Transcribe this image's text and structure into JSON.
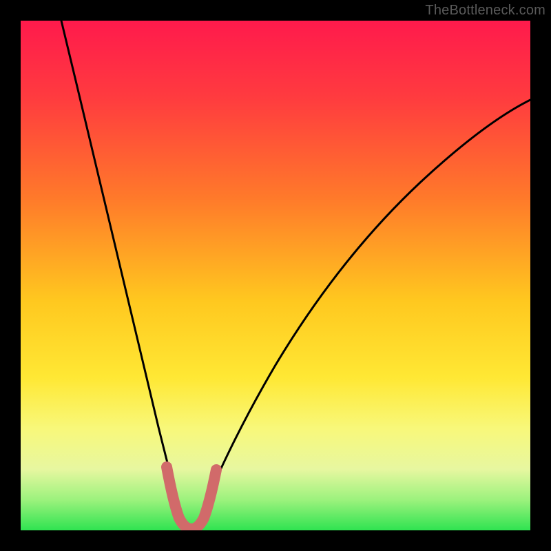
{
  "watermark": "TheBottleneck.com",
  "chart_data": {
    "type": "line",
    "title": "",
    "xlabel": "",
    "ylabel": "",
    "xlim": [
      0,
      100
    ],
    "ylim": [
      0,
      100
    ],
    "grid": false,
    "legend": false,
    "series": [
      {
        "name": "bottleneck-curve",
        "color": "#000000",
        "x": [
          8,
          10,
          12,
          14,
          16,
          18,
          20,
          22,
          24,
          26,
          28,
          30,
          31,
          32,
          33,
          34,
          36,
          38,
          40,
          44,
          48,
          52,
          56,
          60,
          64,
          68,
          72,
          76,
          80,
          84,
          88,
          92,
          96,
          100
        ],
        "y": [
          100,
          92,
          84,
          76,
          68,
          60,
          52,
          44,
          36,
          28,
          20,
          10,
          4,
          1,
          1,
          4,
          10,
          16,
          22,
          32,
          40,
          47,
          53,
          58,
          62,
          66,
          69,
          72,
          74,
          76,
          78,
          79,
          80,
          81
        ]
      },
      {
        "name": "green-band",
        "color": "#2fe351",
        "type": "area",
        "y_range": [
          0,
          4
        ]
      },
      {
        "name": "sweet-spot-marker",
        "color": "#d16a6a",
        "x": [
          28,
          29,
          30,
          31,
          32,
          33,
          34,
          35,
          36
        ],
        "y": [
          12,
          7,
          3,
          1,
          1,
          1,
          3,
          7,
          12
        ]
      }
    ],
    "gradient_stops": [
      {
        "pct": 0,
        "color": "#ff1a4c"
      },
      {
        "pct": 15,
        "color": "#ff3b3f"
      },
      {
        "pct": 35,
        "color": "#ff7a2a"
      },
      {
        "pct": 55,
        "color": "#ffc81f"
      },
      {
        "pct": 70,
        "color": "#ffe834"
      },
      {
        "pct": 80,
        "color": "#f8f87a"
      },
      {
        "pct": 88,
        "color": "#e7f7a0"
      },
      {
        "pct": 94,
        "color": "#9cf27d"
      },
      {
        "pct": 100,
        "color": "#2fe351"
      }
    ]
  }
}
